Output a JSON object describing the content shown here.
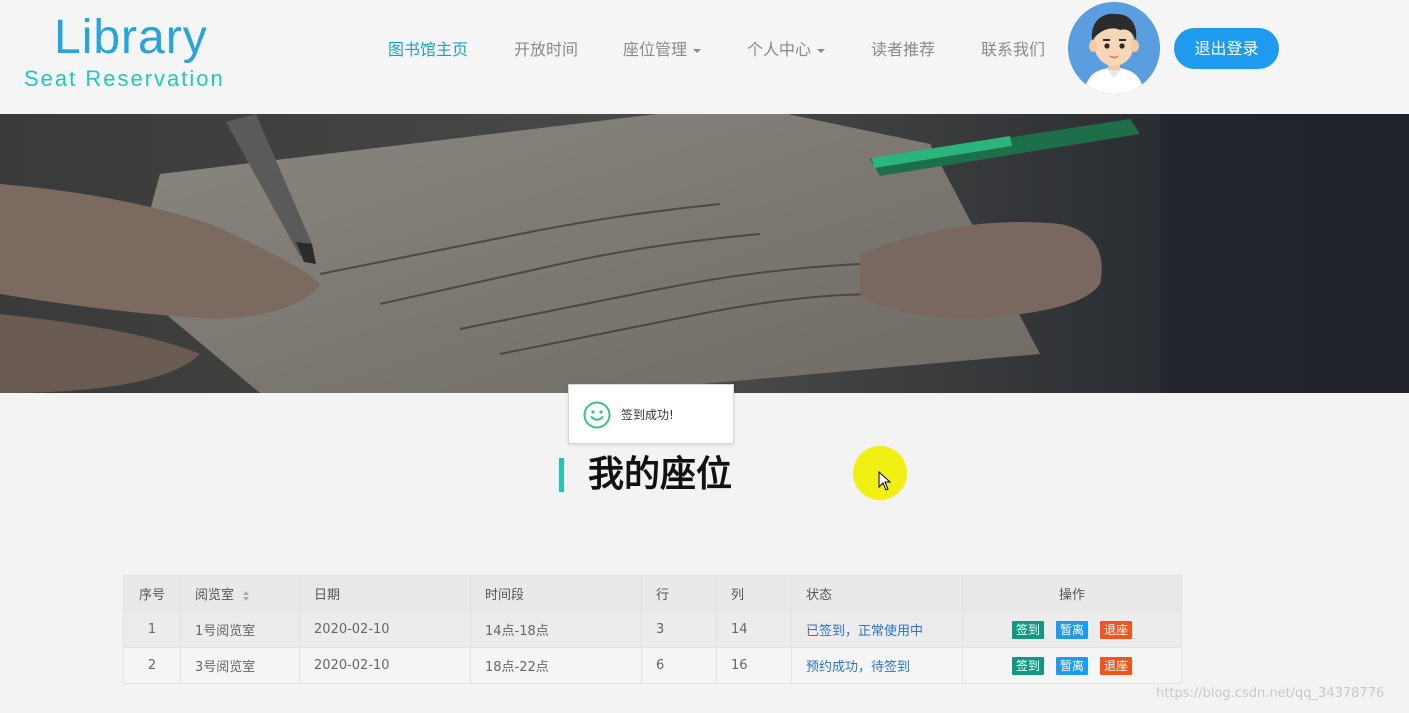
{
  "header": {
    "logo_title": "Library",
    "logo_subtitle": "Seat Reservation",
    "nav": [
      {
        "label": "图书馆主页",
        "active": true,
        "dropdown": false
      },
      {
        "label": "开放时间",
        "active": false,
        "dropdown": false
      },
      {
        "label": "座位管理",
        "active": false,
        "dropdown": true
      },
      {
        "label": "个人中心",
        "active": false,
        "dropdown": true
      },
      {
        "label": "读者推荐",
        "active": false,
        "dropdown": false
      },
      {
        "label": "联系我们",
        "active": false,
        "dropdown": false
      }
    ],
    "logout_label": "退出登录"
  },
  "toast": {
    "message": "签到成功!",
    "icon": "smile-icon"
  },
  "section": {
    "title": "我的座位"
  },
  "table": {
    "headers": [
      "序号",
      "阅览室",
      "日期",
      "时间段",
      "行",
      "列",
      "状态",
      "操作"
    ],
    "rows": [
      {
        "index": "1",
        "room": "1号阅览室",
        "date": "2020-02-10",
        "period": "14点-18点",
        "row": "3",
        "col": "14",
        "status": "已签到，正常使用中"
      },
      {
        "index": "2",
        "room": "3号阅览室",
        "date": "2020-02-10",
        "period": "18点-22点",
        "row": "6",
        "col": "16",
        "status": "预约成功，待签到"
      }
    ],
    "actions": {
      "sign_in": "签到",
      "pause": "暂离",
      "leave": "退座"
    }
  },
  "watermark": "https://blog.csdn.net/qq_34378776",
  "colors": {
    "accent": "#1ba3c7",
    "logout": "#1e9bef",
    "sign_in": "#129880",
    "pause": "#1e9bef",
    "leave": "#f1541d",
    "status_text": "#2d73c9"
  }
}
